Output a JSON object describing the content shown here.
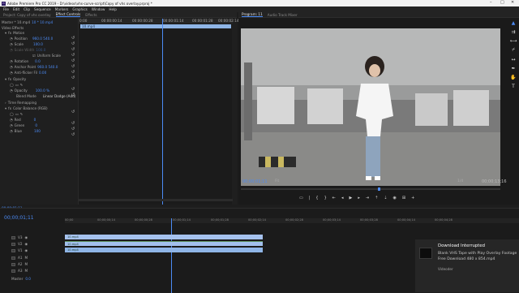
{
  "window": {
    "title": "Adobe Premiere Pro CC 2019 - D:\\videos\\vhs-curve-script\\Copy of vhs overlay.prproj *"
  },
  "menu": [
    "File",
    "Edit",
    "Clip",
    "Sequence",
    "Markers",
    "Graphics",
    "Window",
    "Help"
  ],
  "left_panel": {
    "tabs": [
      "Project: Copy of vhs overlay",
      "Effect Controls",
      "Effects"
    ],
    "source_label": "Master * 10.mp4",
    "seq_label": "10 * 10.mp4",
    "section_video": "Video Effects",
    "motion": "Motion",
    "rows": [
      {
        "label": "Position",
        "values": "960.0    540.0"
      },
      {
        "label": "Scale",
        "values": "100.0"
      },
      {
        "label": "Scale Width",
        "values": "100.0"
      },
      {
        "label": "",
        "values": "Uniform Scale"
      },
      {
        "label": "Rotation",
        "values": "0.0"
      },
      {
        "label": "Anchor Point",
        "values": "960.0    540.0"
      },
      {
        "label": "Anti-flicker Fil",
        "values": "0.00"
      }
    ],
    "opacity": "Opacity",
    "opacity_val": "100.0 %",
    "blend": "Blend Mode",
    "blend_val": "Linear Dodge (Add)",
    "time_remap": "Time Remapping",
    "color_balance": "Color Balance (RGB)",
    "rgb": [
      {
        "label": "Red",
        "values": "0"
      },
      {
        "label": "Green",
        "values": "0"
      },
      {
        "label": "Blue",
        "values": "100"
      }
    ],
    "ruler_times": [
      "0:00",
      "00:00:00:14",
      "00:00:00:28",
      "00:00:01:14",
      "00:00:01:28",
      "00:00:02:14"
    ],
    "clip_label": "10.mp4",
    "timecode": "00:00:01:11"
  },
  "program": {
    "tabs": [
      "Program: 11",
      "Audio Track Mixer"
    ],
    "timecode_left": "00;00;01;11",
    "fit": "Fit",
    "quality": "1/4",
    "timecode_right": "00;00;13;16"
  },
  "timeline": {
    "timecode": "00;00;01;11",
    "ruler": [
      "00;00",
      "00;00;00;14",
      "00;00;00;28",
      "00;00;01;14",
      "00;00;01;28",
      "00;00;02;14",
      "00;00;02;28",
      "00;00;03;14",
      "00;00;03;28",
      "00;00;04;14",
      "00;00;04;28"
    ],
    "tracks": [
      "V3",
      "V2",
      "V1",
      "A1",
      "A2",
      "A3"
    ],
    "master": "Master",
    "master_val": "0.0",
    "clips": [
      "10.mp4",
      "10.mp4",
      "10.mp4"
    ]
  },
  "toast": {
    "title": "Download Interrupted",
    "body": "Blank VHS Tape with Play Overlay Footage  Free Download 480 x 854.mp4",
    "source": "Videoder"
  }
}
